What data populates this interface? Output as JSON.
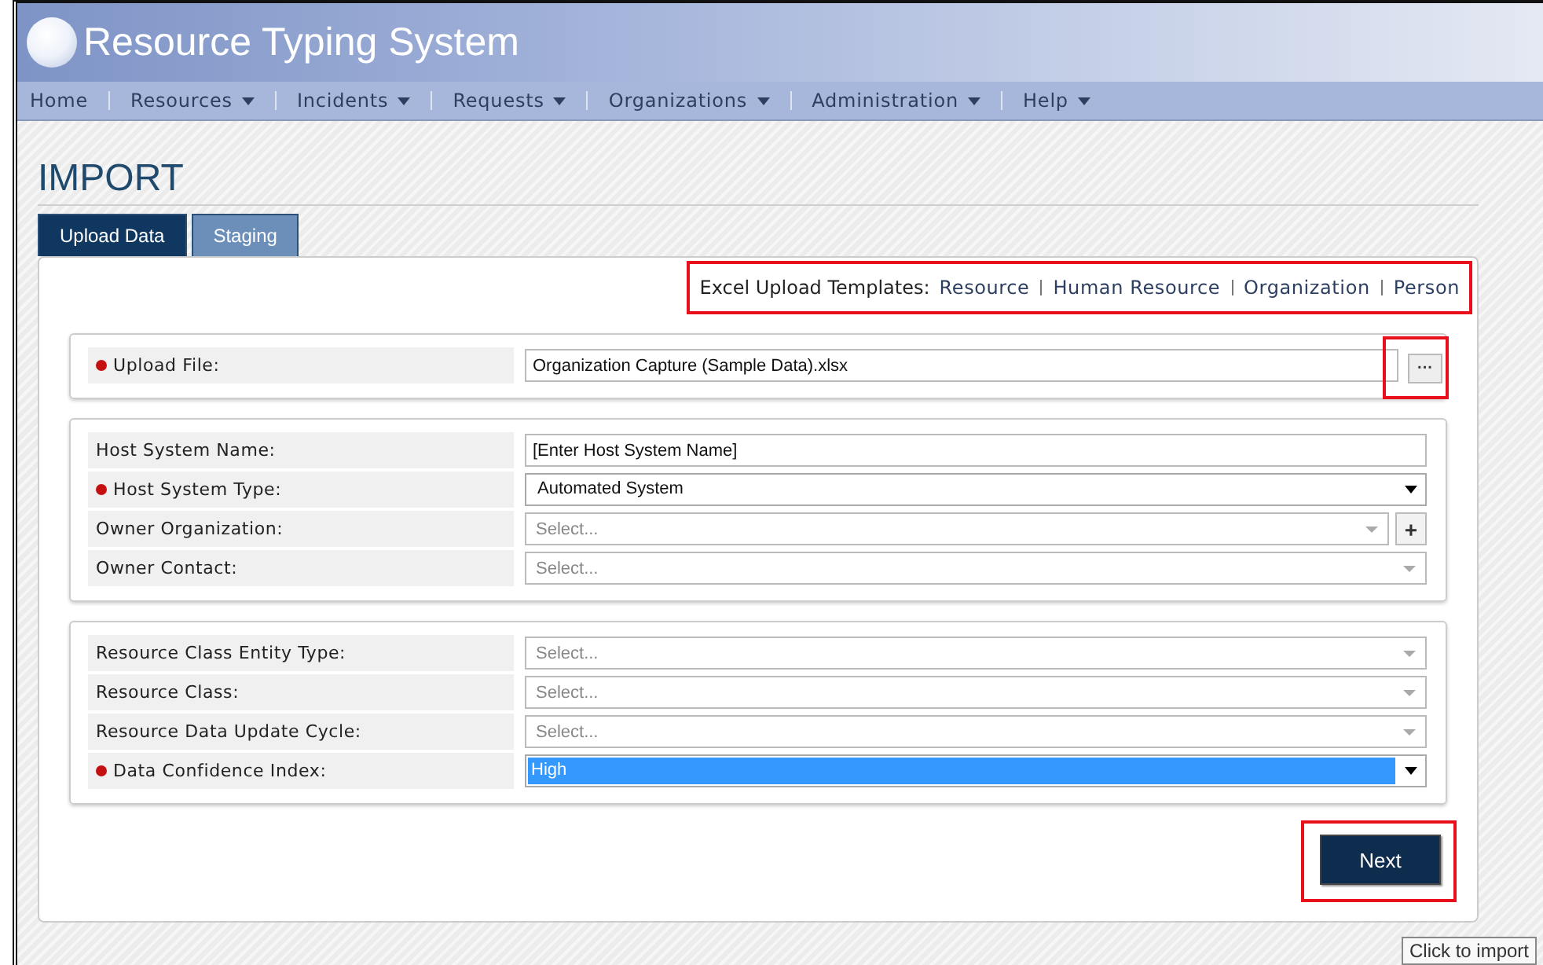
{
  "app_title": "Resource Typing System",
  "nav": [
    {
      "label": "Home",
      "dropdown": false
    },
    {
      "label": "Resources",
      "dropdown": true
    },
    {
      "label": "Incidents",
      "dropdown": true
    },
    {
      "label": "Requests",
      "dropdown": true
    },
    {
      "label": "Organizations",
      "dropdown": true
    },
    {
      "label": "Administration",
      "dropdown": true
    },
    {
      "label": "Help",
      "dropdown": true
    }
  ],
  "page_title": "IMPORT",
  "tabs": [
    {
      "label": "Upload Data",
      "selected": true
    },
    {
      "label": "Staging",
      "selected": false
    }
  ],
  "templates": {
    "label": "Excel Upload Templates:",
    "links": [
      "Resource",
      "Human Resource",
      "Organization",
      "Person"
    ],
    "highlighted": true
  },
  "sections": [
    {
      "fields": [
        {
          "label": "Upload File:",
          "required": true,
          "kind": "file",
          "value": "Organization Capture (Sample Data).xlsx",
          "browse": "···",
          "browse_highlighted": true
        }
      ]
    },
    {
      "fields": [
        {
          "label": "Host System Name:",
          "required": false,
          "kind": "text",
          "value": "[Enter Host System Name]"
        },
        {
          "label": "Host System Type:",
          "required": true,
          "kind": "select",
          "value": "Automated System",
          "selected": false
        },
        {
          "label": "Owner Organization:",
          "required": false,
          "kind": "combo",
          "placeholder": "Select...",
          "add": "+"
        },
        {
          "label": "Owner Contact:",
          "required": false,
          "kind": "combo",
          "placeholder": "Select..."
        }
      ]
    },
    {
      "fields": [
        {
          "label": "Resource Class Entity Type:",
          "required": false,
          "kind": "combo",
          "placeholder": "Select..."
        },
        {
          "label": "Resource Class:",
          "required": false,
          "kind": "combo",
          "placeholder": "Select..."
        },
        {
          "label": "Resource Data Update Cycle:",
          "required": false,
          "kind": "combo",
          "placeholder": "Select..."
        },
        {
          "label": "Data Confidence Index:",
          "required": true,
          "kind": "select",
          "value": "High",
          "selected": true
        }
      ]
    }
  ],
  "next_button": {
    "label": "Next",
    "highlighted": true
  },
  "tooltip": "Click to import"
}
